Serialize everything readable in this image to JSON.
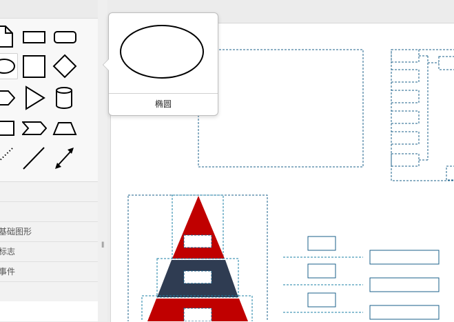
{
  "sidebar": {
    "categories": [
      {
        "label": ""
      },
      {
        "label": "基础图形"
      },
      {
        "label": "标志"
      },
      {
        "label": "事件"
      }
    ],
    "shapes": [
      {
        "name": "document-shape-icon"
      },
      {
        "name": "rectangle-shape-icon"
      },
      {
        "name": "rounded-rectangle-shape-icon"
      },
      {
        "name": "ellipse-shape-icon"
      },
      {
        "name": "square-shape-icon"
      },
      {
        "name": "diamond-shape-icon"
      },
      {
        "name": "pentagon-arrow-shape-icon"
      },
      {
        "name": "triangle-shape-icon"
      },
      {
        "name": "cylinder-shape-icon"
      },
      {
        "name": "card-shape-icon"
      },
      {
        "name": "chevron-shape-icon"
      },
      {
        "name": "trapezoid-shape-icon"
      },
      {
        "name": "dotted-line-shape-icon"
      },
      {
        "name": "line-shape-icon"
      },
      {
        "name": "double-arrow-line-shape-icon"
      }
    ]
  },
  "tooltip": {
    "label": "椭圆",
    "preview_icon": "ellipse-preview-icon"
  },
  "colors": {
    "pyramid_red": "#c00000",
    "pyramid_navy": "#2f3c52",
    "selection_dash": "#1a7fa6"
  }
}
